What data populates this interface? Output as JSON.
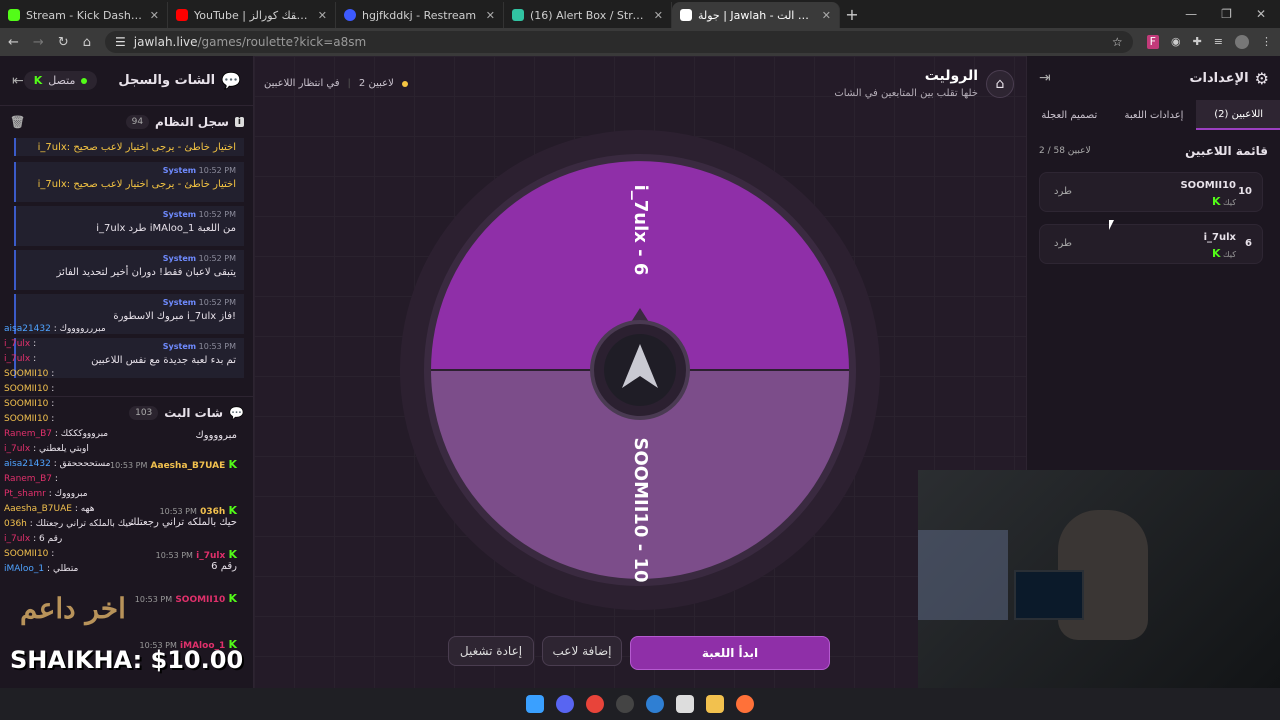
{
  "browser": {
    "tabs": [
      {
        "title": "Stream - Kick Dashboard",
        "color": "#53fc18"
      },
      {
        "title": "YouTube | أنا بعشقك كورالز",
        "color": "#ff0000"
      },
      {
        "title": "hgjfkddkj - Restream",
        "color": "#3d5afe"
      },
      {
        "title": "(16) Alert Box / Streamlabs",
        "color": "#31c3a2"
      },
      {
        "title": "جولة | Jawlah - منصة الألعاب الت...",
        "color": "#ffffff"
      }
    ],
    "url_host": "jawlah.live",
    "url_path": "/games/roulette?kick=a8sm",
    "ext_letter": "F"
  },
  "chat": {
    "title": "الشات والسجل",
    "status": "متصل",
    "system_log_title": "سجل النظام",
    "system_log_count": "94",
    "logs": [
      {
        "who": "System",
        "time": "10:52 PM",
        "msg": "i_7ulx: اختيار خاطئ - يرجى اختيار لاعب صحيح",
        "warn": true
      },
      {
        "who": "System",
        "time": "10:52 PM",
        "msg": "i_7ulx طرد iMAloo_1 من اللعبة",
        "warn": false
      },
      {
        "who": "System",
        "time": "10:52 PM",
        "msg": "يتبقى لاعبان فقط! دوران أخير لتحديد الفائز",
        "warn": false
      },
      {
        "who": "System",
        "time": "10:52 PM",
        "msg": "مبروك الاسطورة i_7ulx فاز!",
        "warn": false
      },
      {
        "who": "System",
        "time": "10:53 PM",
        "msg": "تم بدء لعبة جديدة مع نفس اللاعبين",
        "warn": false
      }
    ],
    "top_log": "i_7ulx: اختيار خاطئ - يرجى اختيار لاعب صحيح",
    "stream_chat_title": "شات البث",
    "stream_chat_count": "103",
    "overlay_lines": [
      {
        "name": "aisa21432",
        "text": ": مبرررووووك",
        "color": "#4fa3ff"
      },
      {
        "name": "i_7ulx",
        "text": ":",
        "color": "#e0306b"
      },
      {
        "name": "i_7ulx",
        "text": ":",
        "color": "#e0306b"
      },
      {
        "name": "SOOMII10",
        "text": ":",
        "color": "#f2c14e"
      },
      {
        "name": "SOOMII10",
        "text": ":",
        "color": "#f2c14e"
      },
      {
        "name": "SOOMII10",
        "text": ":",
        "color": "#f2c14e"
      },
      {
        "name": "SOOMII10",
        "text": ":",
        "color": "#f2c14e"
      },
      {
        "name": "Ranem_B7",
        "text": ": مبروووكككك",
        "color": "#e0306b"
      },
      {
        "name": "i_7ulx",
        "text": ": اوبتي يلعطني",
        "color": "#e0306b"
      },
      {
        "name": "aisa21432",
        "text": ": مستححححقق",
        "color": "#4fa3ff"
      },
      {
        "name": "Ranem_B7",
        "text": ":",
        "color": "#e0306b"
      },
      {
        "name": "Pt_shamr",
        "text": ": مبروووك",
        "color": "#e0306b"
      },
      {
        "name": "Aaesha_B7UAE",
        "text": ": ههه",
        "color": "#f2c14e"
      },
      {
        "name": "036h",
        "text": ": حيك بالملكه تراني رجعتلك",
        "color": "#f2c14e"
      },
      {
        "name": "i_7ulx",
        "text": ": رقم 6",
        "color": "#e0306b"
      },
      {
        "name": "SOOMII10",
        "text": ":",
        "color": "#f2c14e"
      },
      {
        "name": "iMAloo_1",
        "text": ": متطلي",
        "color": "#4fa3ff"
      }
    ],
    "messages": [
      {
        "name": "",
        "time": "",
        "text": "مبرووووك"
      },
      {
        "name": "Aaesha_B7UAE",
        "time": "10:53 PM",
        "text": ""
      },
      {
        "name": "036h",
        "time": "10:53 PM",
        "text": "حيك بالملكه تراني رجعتلك"
      },
      {
        "name": "i_7ulx",
        "time": "10:53 PM",
        "text": "رقم 6"
      },
      {
        "name": "SOOMII10",
        "time": "10:53 PM",
        "text": ""
      },
      {
        "name": "iMAloo_1",
        "time": "10:53 PM",
        "text": ""
      }
    ],
    "donor_banner": "اخر داعم",
    "donor_amount": "SHAIKHA: $10.00"
  },
  "game": {
    "title": "الروليت",
    "subtitle": "خلها تقلب بين المتابعين في الشات",
    "players_count": "2 لاعبين",
    "waiting": "في انتظار اللاعبين",
    "wheel": {
      "segments": [
        {
          "label": "i_7ulx - 6",
          "color": "#8f2fa8"
        },
        {
          "label": "SOOMII10 - 10",
          "color": "#7c4d8a"
        }
      ]
    },
    "buttons": {
      "start": "ابدأ اللعبة",
      "add_player": "إضافة لاعب",
      "restart": "إعادة تشغيل"
    },
    "accent": "#9b3fc1"
  },
  "settings": {
    "title": "الإعدادات",
    "tabs": [
      "اللاعبين (2)",
      "إعدادات اللعبة",
      "تصميم العجلة"
    ],
    "list_title": "قائمة اللاعبين",
    "list_count": "2 / 58 لاعبين",
    "players": [
      {
        "name": "SOOMII10",
        "number": "10",
        "platform": "كيك",
        "kick": "طرد"
      },
      {
        "name": "i_7ulx",
        "number": "6",
        "platform": "كيك",
        "kick": "طرد"
      }
    ]
  }
}
